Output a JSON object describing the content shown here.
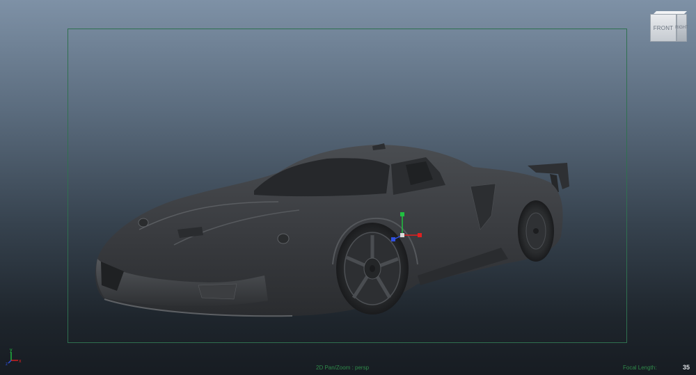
{
  "viewport": {
    "camera_label": "2D Pan/Zoom : persp",
    "focal_length_label": "Focal Length:",
    "focal_length_value": "35"
  },
  "viewcube": {
    "front_label": "FRONT",
    "right_label": "RIGHT"
  },
  "axis_indicator": {
    "y_label": "y",
    "x_label": "x",
    "z_label": "z"
  },
  "colors": {
    "gate": "#2f7050",
    "hud_text": "#2f8a4a",
    "axis_x": "#e02020",
    "axis_y": "#20c040",
    "axis_z": "#3050e0"
  },
  "icons": [
    "viewcube-icon",
    "manipulator-icon",
    "axis-indicator-icon"
  ]
}
